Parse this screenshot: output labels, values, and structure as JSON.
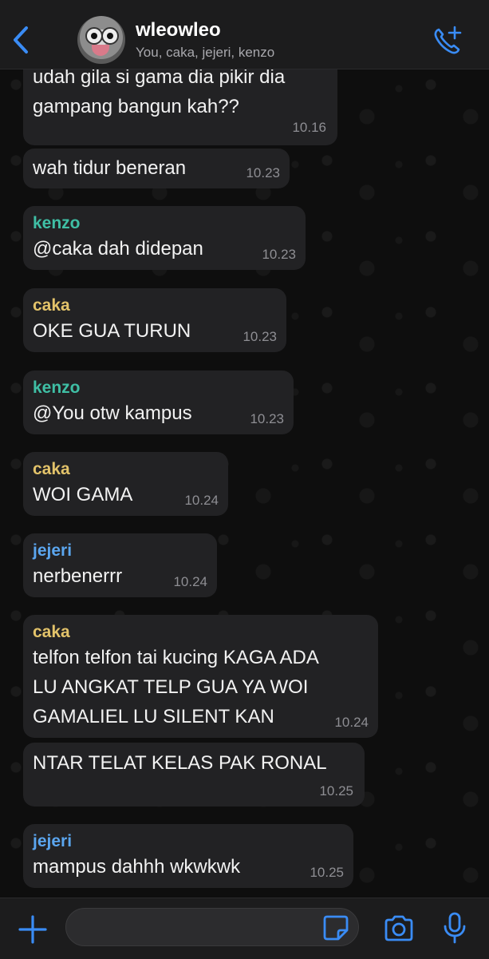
{
  "header": {
    "back_icon": "chevron-left-icon",
    "group_name": "wleowleo",
    "members": "You, caka, jejeri, kenzo",
    "call_icon": "phone-plus-icon"
  },
  "colors": {
    "accent": "#3a8cf5",
    "kenzo": "#3fbfa5",
    "caka": "#e3c36a",
    "jejeri": "#5ba6ef",
    "bubble": "#222224"
  },
  "messages": [
    {
      "sender": "",
      "text": "udah gila si gama dia pikir dia\ngampang bangun kah??",
      "time": "10.16"
    },
    {
      "sender": "",
      "text": "wah tidur beneran",
      "time": "10.23"
    },
    {
      "sender": "kenzo",
      "text": "@caka dah didepan",
      "time": "10.23"
    },
    {
      "sender": "caka",
      "text": "OKE GUA TURUN",
      "time": "10.23"
    },
    {
      "sender": "kenzo",
      "text": "@You otw kampus",
      "time": "10.23"
    },
    {
      "sender": "caka",
      "text": "WOI GAMA",
      "time": "10.24"
    },
    {
      "sender": "jejeri",
      "text": "nerbenerrr",
      "time": "10.24"
    },
    {
      "sender": "caka",
      "text": "telfon telfon tai kucing KAGA ADA\nLU ANGKAT TELP GUA YA WOI\nGAMALIEL LU SILENT KAN",
      "time": "10.24"
    },
    {
      "sender": "",
      "text": "NTAR TELAT KELAS PAK RONAL",
      "time": "10.25"
    },
    {
      "sender": "jejeri",
      "text": "mampus dahhh wkwkwk",
      "time": "10.25"
    }
  ],
  "composer": {
    "plus_icon": "plus-icon",
    "input_value": "",
    "sticker_icon": "sticker-icon",
    "camera_icon": "camera-icon",
    "mic_icon": "microphone-icon"
  }
}
